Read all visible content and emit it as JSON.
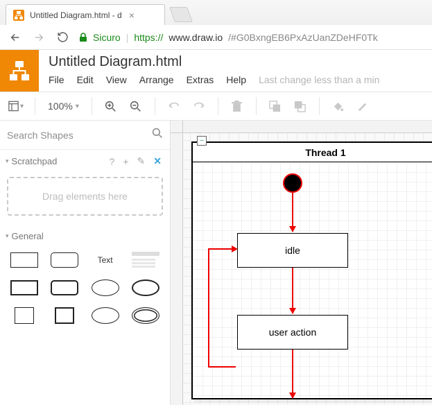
{
  "browser": {
    "tab_title": "Untitled Diagram.html - d",
    "secure_label": "Sicuro",
    "url_protocol": "https://",
    "url_host": "www.draw.io",
    "url_path": "/#G0BxngEB6PxAzUanZDeHF0Tk"
  },
  "app": {
    "doc_title": "Untitled Diagram.html",
    "menu": {
      "file": "File",
      "edit": "Edit",
      "view": "View",
      "arrange": "Arrange",
      "extras": "Extras",
      "help": "Help"
    },
    "status": "Last change less than a min"
  },
  "toolbar": {
    "zoom": "100%"
  },
  "sidebar": {
    "search_placeholder": "Search Shapes",
    "scratchpad_label": "Scratchpad",
    "scratchpad_help": "?",
    "dropzone": "Drag elements here",
    "general_label": "General",
    "text_shape_label": "Text"
  },
  "diagram": {
    "frame_title": "Thread 1",
    "collapse_glyph": "−",
    "state_idle": "idle",
    "state_user_action": "user action"
  },
  "chart_data": {
    "type": "uml-state-diagram",
    "swimlane": "Thread 1",
    "nodes": [
      {
        "id": "start",
        "kind": "initial"
      },
      {
        "id": "idle",
        "kind": "state",
        "label": "idle"
      },
      {
        "id": "user_action",
        "kind": "state",
        "label": "user action"
      }
    ],
    "edges": [
      {
        "from": "start",
        "to": "idle"
      },
      {
        "from": "idle",
        "to": "user_action"
      },
      {
        "from": "user_action",
        "to": "idle",
        "loopback": true
      }
    ]
  }
}
